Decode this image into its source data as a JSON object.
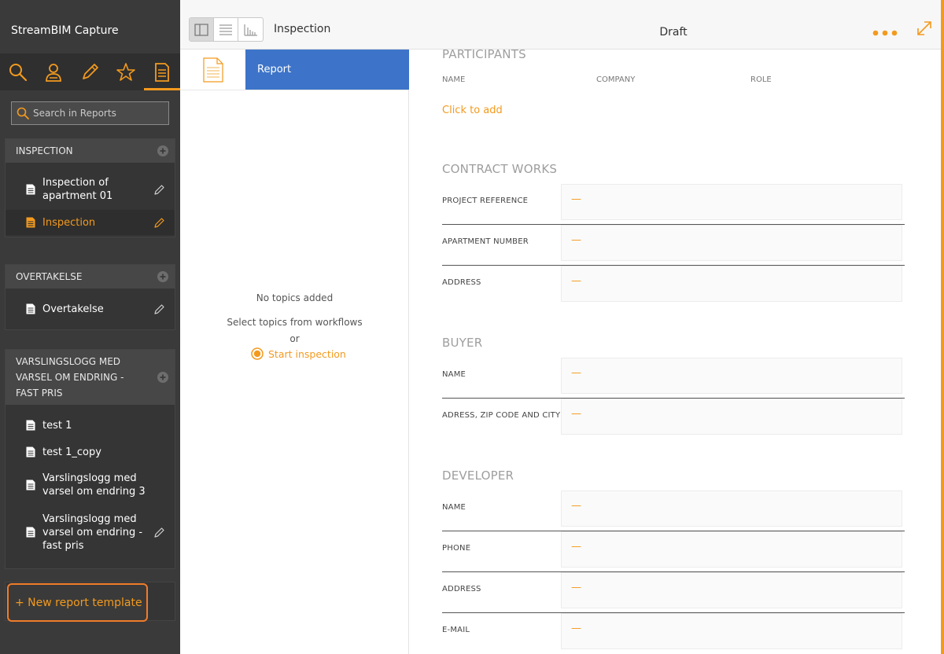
{
  "app": {
    "title": "StreamBIM Capture"
  },
  "nav_icons": [
    "search-icon",
    "user-icon",
    "pencil-icon",
    "star-icon",
    "report-icon"
  ],
  "colors": {
    "accent": "#f39a1e",
    "sidebar": "#3a3a3a",
    "selected": "#3d74c9",
    "highlight_border": "#f07c2a"
  },
  "search": {
    "placeholder": "Search in Reports"
  },
  "groups": [
    {
      "title": "INSPECTION",
      "items": [
        {
          "label": "Inspection of apartment 01",
          "editable": true,
          "active": false
        },
        {
          "label": "Inspection",
          "editable": true,
          "active": true
        }
      ]
    },
    {
      "title": "OVERTAKELSE",
      "items": [
        {
          "label": "Overtakelse",
          "editable": true,
          "active": false
        }
      ]
    },
    {
      "title": "VARSLINGSLOGG MED VARSEL OM ENDRING - FAST PRIS",
      "items": [
        {
          "label": "test 1",
          "editable": false,
          "active": false
        },
        {
          "label": "test 1_copy",
          "editable": false,
          "active": false
        },
        {
          "label": "Varslingslogg med varsel om endring 3",
          "editable": false,
          "active": false
        },
        {
          "label": "Varslingslogg med varsel om endring - fast pris",
          "editable": true,
          "active": false
        }
      ]
    }
  ],
  "new_template": {
    "label": "+ New report template"
  },
  "middle": {
    "title": "Inspection",
    "report_tab": "Report",
    "empty": {
      "line1": "No topics added",
      "line2": "Select topics from workflows",
      "or": "or",
      "start": "Start inspection"
    }
  },
  "right": {
    "status": "Draft",
    "participants": {
      "title": "PARTICIPANTS",
      "columns": [
        "NAME",
        "COMPANY",
        "ROLE"
      ],
      "add_label": "Click to add"
    },
    "sections": [
      {
        "title": "CONTRACT WORKS",
        "fields": [
          {
            "label": "PROJECT REFERENCE",
            "value": "—"
          },
          {
            "label": "APARTMENT NUMBER",
            "value": "—"
          },
          {
            "label": "ADDRESS",
            "value": "—"
          }
        ]
      },
      {
        "title": "BUYER",
        "fields": [
          {
            "label": "NAME",
            "value": "—"
          },
          {
            "label": "ADRESS, ZIP CODE AND CITY",
            "value": "—"
          }
        ]
      },
      {
        "title": "DEVELOPER",
        "fields": [
          {
            "label": "NAME",
            "value": "—"
          },
          {
            "label": "PHONE",
            "value": "—"
          },
          {
            "label": "ADDRESS",
            "value": "—"
          },
          {
            "label": "E-MAIL",
            "value": "—"
          }
        ]
      }
    ]
  }
}
